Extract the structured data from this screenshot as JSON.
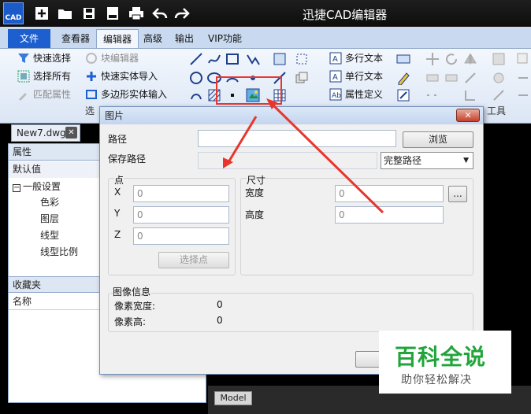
{
  "app": {
    "logo_text": "CAD",
    "title": "迅捷CAD编辑器"
  },
  "tabs": [
    {
      "label": "文件"
    },
    {
      "label": "查看器"
    },
    {
      "label": "编辑器"
    },
    {
      "label": "高级"
    },
    {
      "label": "输出"
    },
    {
      "label": "VIP功能"
    }
  ],
  "ribbon": {
    "left_items": [
      "快速选择",
      "选择所有",
      "匹配属性"
    ],
    "middle_items": [
      "块编辑器",
      "快速实体导入",
      "多边形实体输入"
    ],
    "text_items": [
      "多行文本",
      "单行文本",
      "属性定义"
    ],
    "group_labels": {
      "select": "选",
      "tools": "工具"
    }
  },
  "document": {
    "tab_label": "New7.dwg",
    "model_tab": "Model"
  },
  "left_panel": {
    "properties_header": "属性",
    "default_value": "默认值",
    "general_settings": "一般设置",
    "rows": [
      "色彩",
      "图层",
      "线型",
      "线型比例"
    ],
    "favorites_header": "收藏夹",
    "name_header": "名称"
  },
  "dialog": {
    "title": "图片",
    "close_label": "✕",
    "path_label": "路径",
    "path_value": "",
    "browse_button": "浏览",
    "save_path_label": "保存路径",
    "save_path_value": "",
    "path_mode": "完整路径",
    "point_group": "点",
    "x_label": "X",
    "x_value": "0",
    "y_label": "Y",
    "y_value": "0",
    "z_label": "Z",
    "z_value": "0",
    "pick_point_button": "选择点",
    "size_group": "尺寸",
    "width_label": "宽度",
    "width_value": "0",
    "height_label": "高度",
    "height_value": "0",
    "more_button": "...",
    "image_info_group": "图像信息",
    "pixel_width_label": "像素宽度:",
    "pixel_width_value": "0",
    "pixel_height_label": "像素高:",
    "pixel_height_value": "0"
  },
  "watermark": {
    "brand": "百科全说",
    "slogan": "助你轻松解决"
  },
  "colors": {
    "accent": "#1e5fd0",
    "annotation": "#e8352e",
    "watermark_green": "#21a53b"
  }
}
